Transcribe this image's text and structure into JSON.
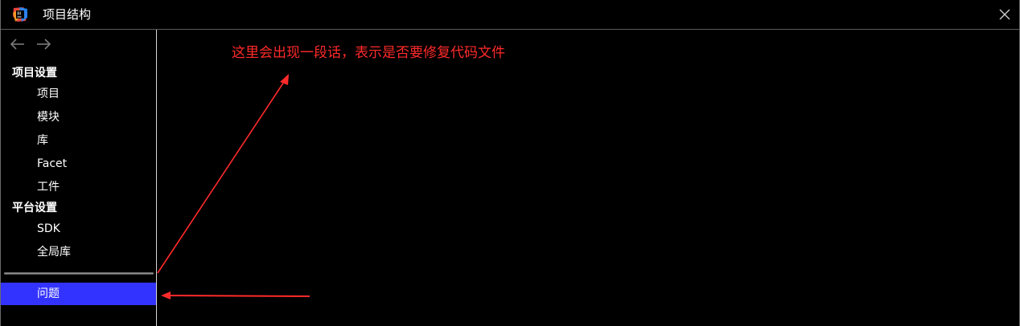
{
  "window": {
    "title": "项目结构"
  },
  "sidebar": {
    "sections": [
      {
        "header": "项目设置",
        "items": [
          {
            "label": "项目"
          },
          {
            "label": "模块"
          },
          {
            "label": "库"
          },
          {
            "label": "Facet"
          },
          {
            "label": "工件"
          }
        ]
      },
      {
        "header": "平台设置",
        "items": [
          {
            "label": "SDK"
          },
          {
            "label": "全局库"
          }
        ]
      }
    ],
    "problems": {
      "label": "问题",
      "selected": true
    }
  },
  "annotation": {
    "text": "这里会出现一段话，表示是否要修复代码文件",
    "color": "#ff2a2a"
  },
  "colors": {
    "selection": "#3333ff",
    "background": "#000000",
    "annotation": "#ff2a2a"
  },
  "icons": {
    "app": "intellij-idea-icon",
    "close": "close-icon",
    "back": "arrow-left-icon",
    "forward": "arrow-right-icon"
  }
}
